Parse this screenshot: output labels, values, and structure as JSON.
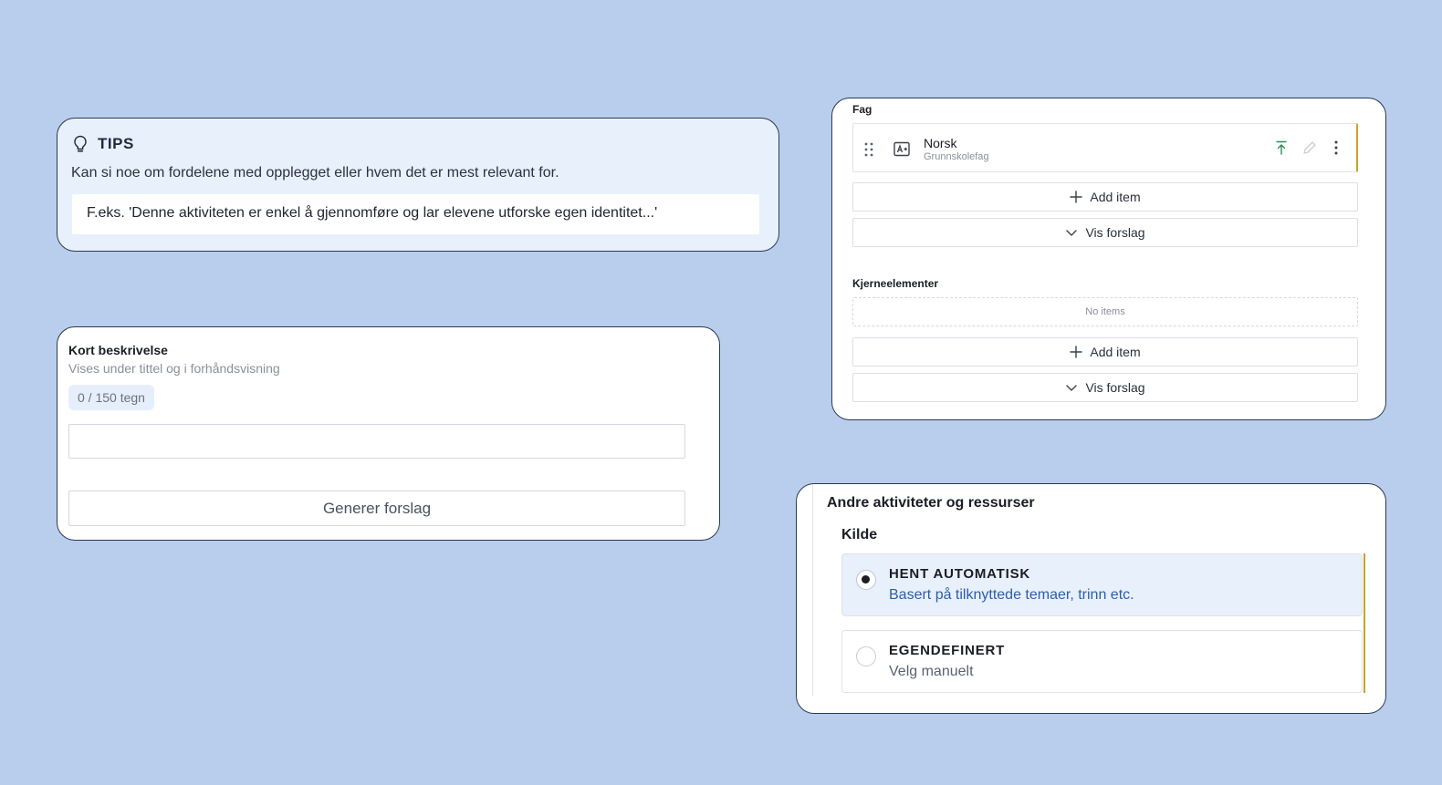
{
  "tips": {
    "icon": "lightbulb-icon",
    "title": "TIPS",
    "text": "Kan si noe om fordelene med opplegget eller hvem det er mest relevant for.",
    "example": "F.eks. 'Denne aktiviteten er enkel å gjennomføre og lar elevene utforske egen identitet...'"
  },
  "description": {
    "label": "Kort beskrivelse",
    "help": "Vises under tittel og i forhåndsvisning",
    "counter": "0 / 150 tegn",
    "input_value": "",
    "generate_label": "Generer forslag"
  },
  "fag": {
    "label": "Fag",
    "item": {
      "name": "Norsk",
      "subtitle": "Grunnskolefag"
    },
    "add_label": "Add item",
    "suggest_label": "Vis forslag"
  },
  "kjerneelementer": {
    "label": "Kjerneelementer",
    "empty_text": "No items",
    "add_label": "Add item",
    "suggest_label": "Vis forslag"
  },
  "andre": {
    "title": "Andre aktiviteter og ressurser",
    "source_label": "Kilde",
    "options": [
      {
        "title": "HENT AUTOMATISK",
        "desc": "Basert på tilknyttede temaer, trinn etc.",
        "selected": true
      },
      {
        "title": "EGENDEFINERT",
        "desc": "Velg manuelt",
        "selected": false
      }
    ]
  },
  "colors": {
    "background": "#b9cdec",
    "tips_bg": "#e8f0fc",
    "accent_gold": "#c9a227",
    "link_blue": "#2d5ea8"
  }
}
